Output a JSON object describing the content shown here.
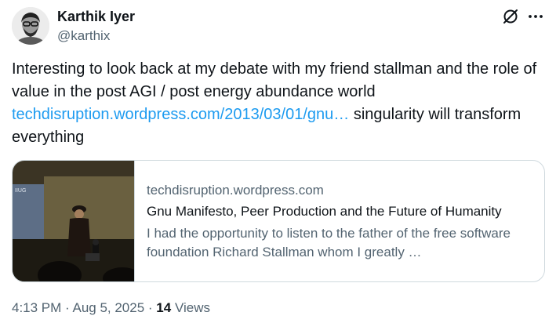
{
  "author": {
    "name": "Karthik Iyer",
    "handle": "@karthix"
  },
  "icons": {
    "grok": "grok-slash-circle-icon",
    "more": "more-horizontal-icon"
  },
  "tweet": {
    "text_part1": "Interesting to look back at my debate with my friend stallman and the role of value in the post AGI / post energy abundance world",
    "link_text": "techdisruption.wordpress.com/2013/03/01/gnu…",
    "text_part2": " singularity will transform everything"
  },
  "card": {
    "domain": "techdisruption.wordpress.com",
    "title": "Gnu Manifesto, Peer Production and the Future of Humanity",
    "description": "I had the opportunity to listen to the father of the free software foundation Richard Stallman whom I greatly …",
    "thumb_banner_text": "IIUG"
  },
  "meta": {
    "time": "4:13 PM",
    "separator1": " · ",
    "date": "Aug 5, 2025",
    "separator2": " · ",
    "views_count": "14",
    "views_label": " Views"
  },
  "colors": {
    "text": "#0f1419",
    "secondary": "#536471",
    "link": "#1d9bf0",
    "border": "#cfd9de"
  }
}
